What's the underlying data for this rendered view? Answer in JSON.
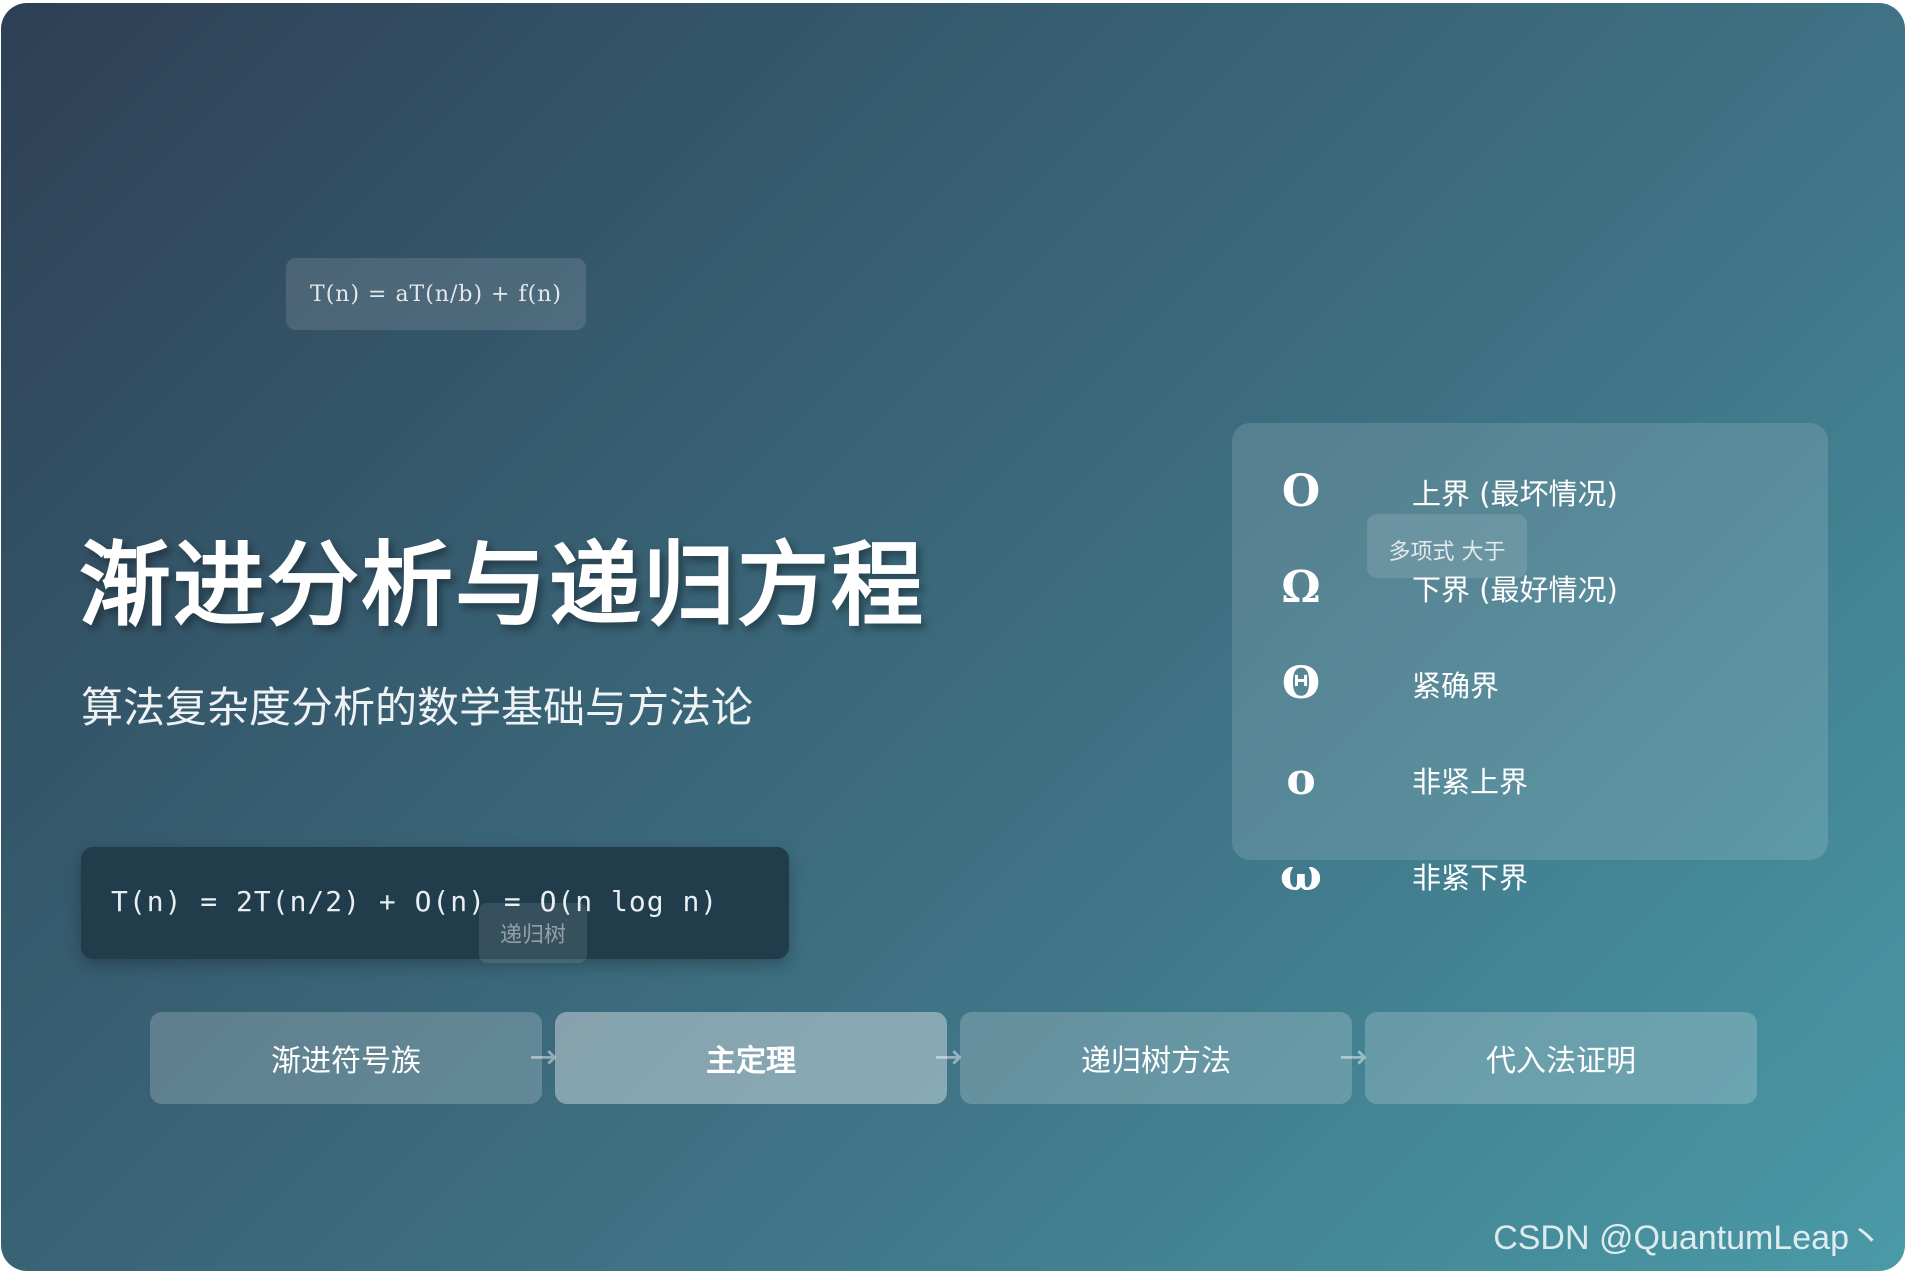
{
  "slide": {
    "top_formula": "T(n) = aT(n/b) + f(n)",
    "title": "渐进分析与递归方程",
    "subtitle": "算法复杂度分析的数学基础与方法论",
    "code_formula": "T(n) = 2T(n/2) + O(n) = O(n log n)",
    "recursion_tree_tag": "递归树"
  },
  "legend": {
    "polynomial_tag": "多项式 大于",
    "items": [
      {
        "symbol": "O",
        "symbol_icon": "big-o-symbol",
        "label": "上界 (最坏情况)"
      },
      {
        "symbol": "Ω",
        "symbol_icon": "big-omega-symbol",
        "label": "下界 (最好情况)"
      },
      {
        "symbol": "Θ",
        "symbol_icon": "big-theta-symbol",
        "label": "紧确界"
      },
      {
        "symbol": "o",
        "symbol_icon": "little-o-symbol",
        "label": "非紧上界"
      },
      {
        "symbol": "ω",
        "symbol_icon": "little-omega-symbol",
        "label": "非紧下界"
      }
    ]
  },
  "flow": {
    "steps": [
      {
        "label": "渐进符号族",
        "active": false
      },
      {
        "label": "主定理",
        "active": true
      },
      {
        "label": "递归树方法",
        "active": false
      },
      {
        "label": "代入法证明",
        "active": false
      }
    ],
    "arrow": "→"
  },
  "watermark": "CSDN @QuantumLeap丶",
  "colors": {
    "gradient_start": "#2e3f55",
    "gradient_end": "#4a9aa7",
    "code_box_bg": "#213d4b"
  }
}
